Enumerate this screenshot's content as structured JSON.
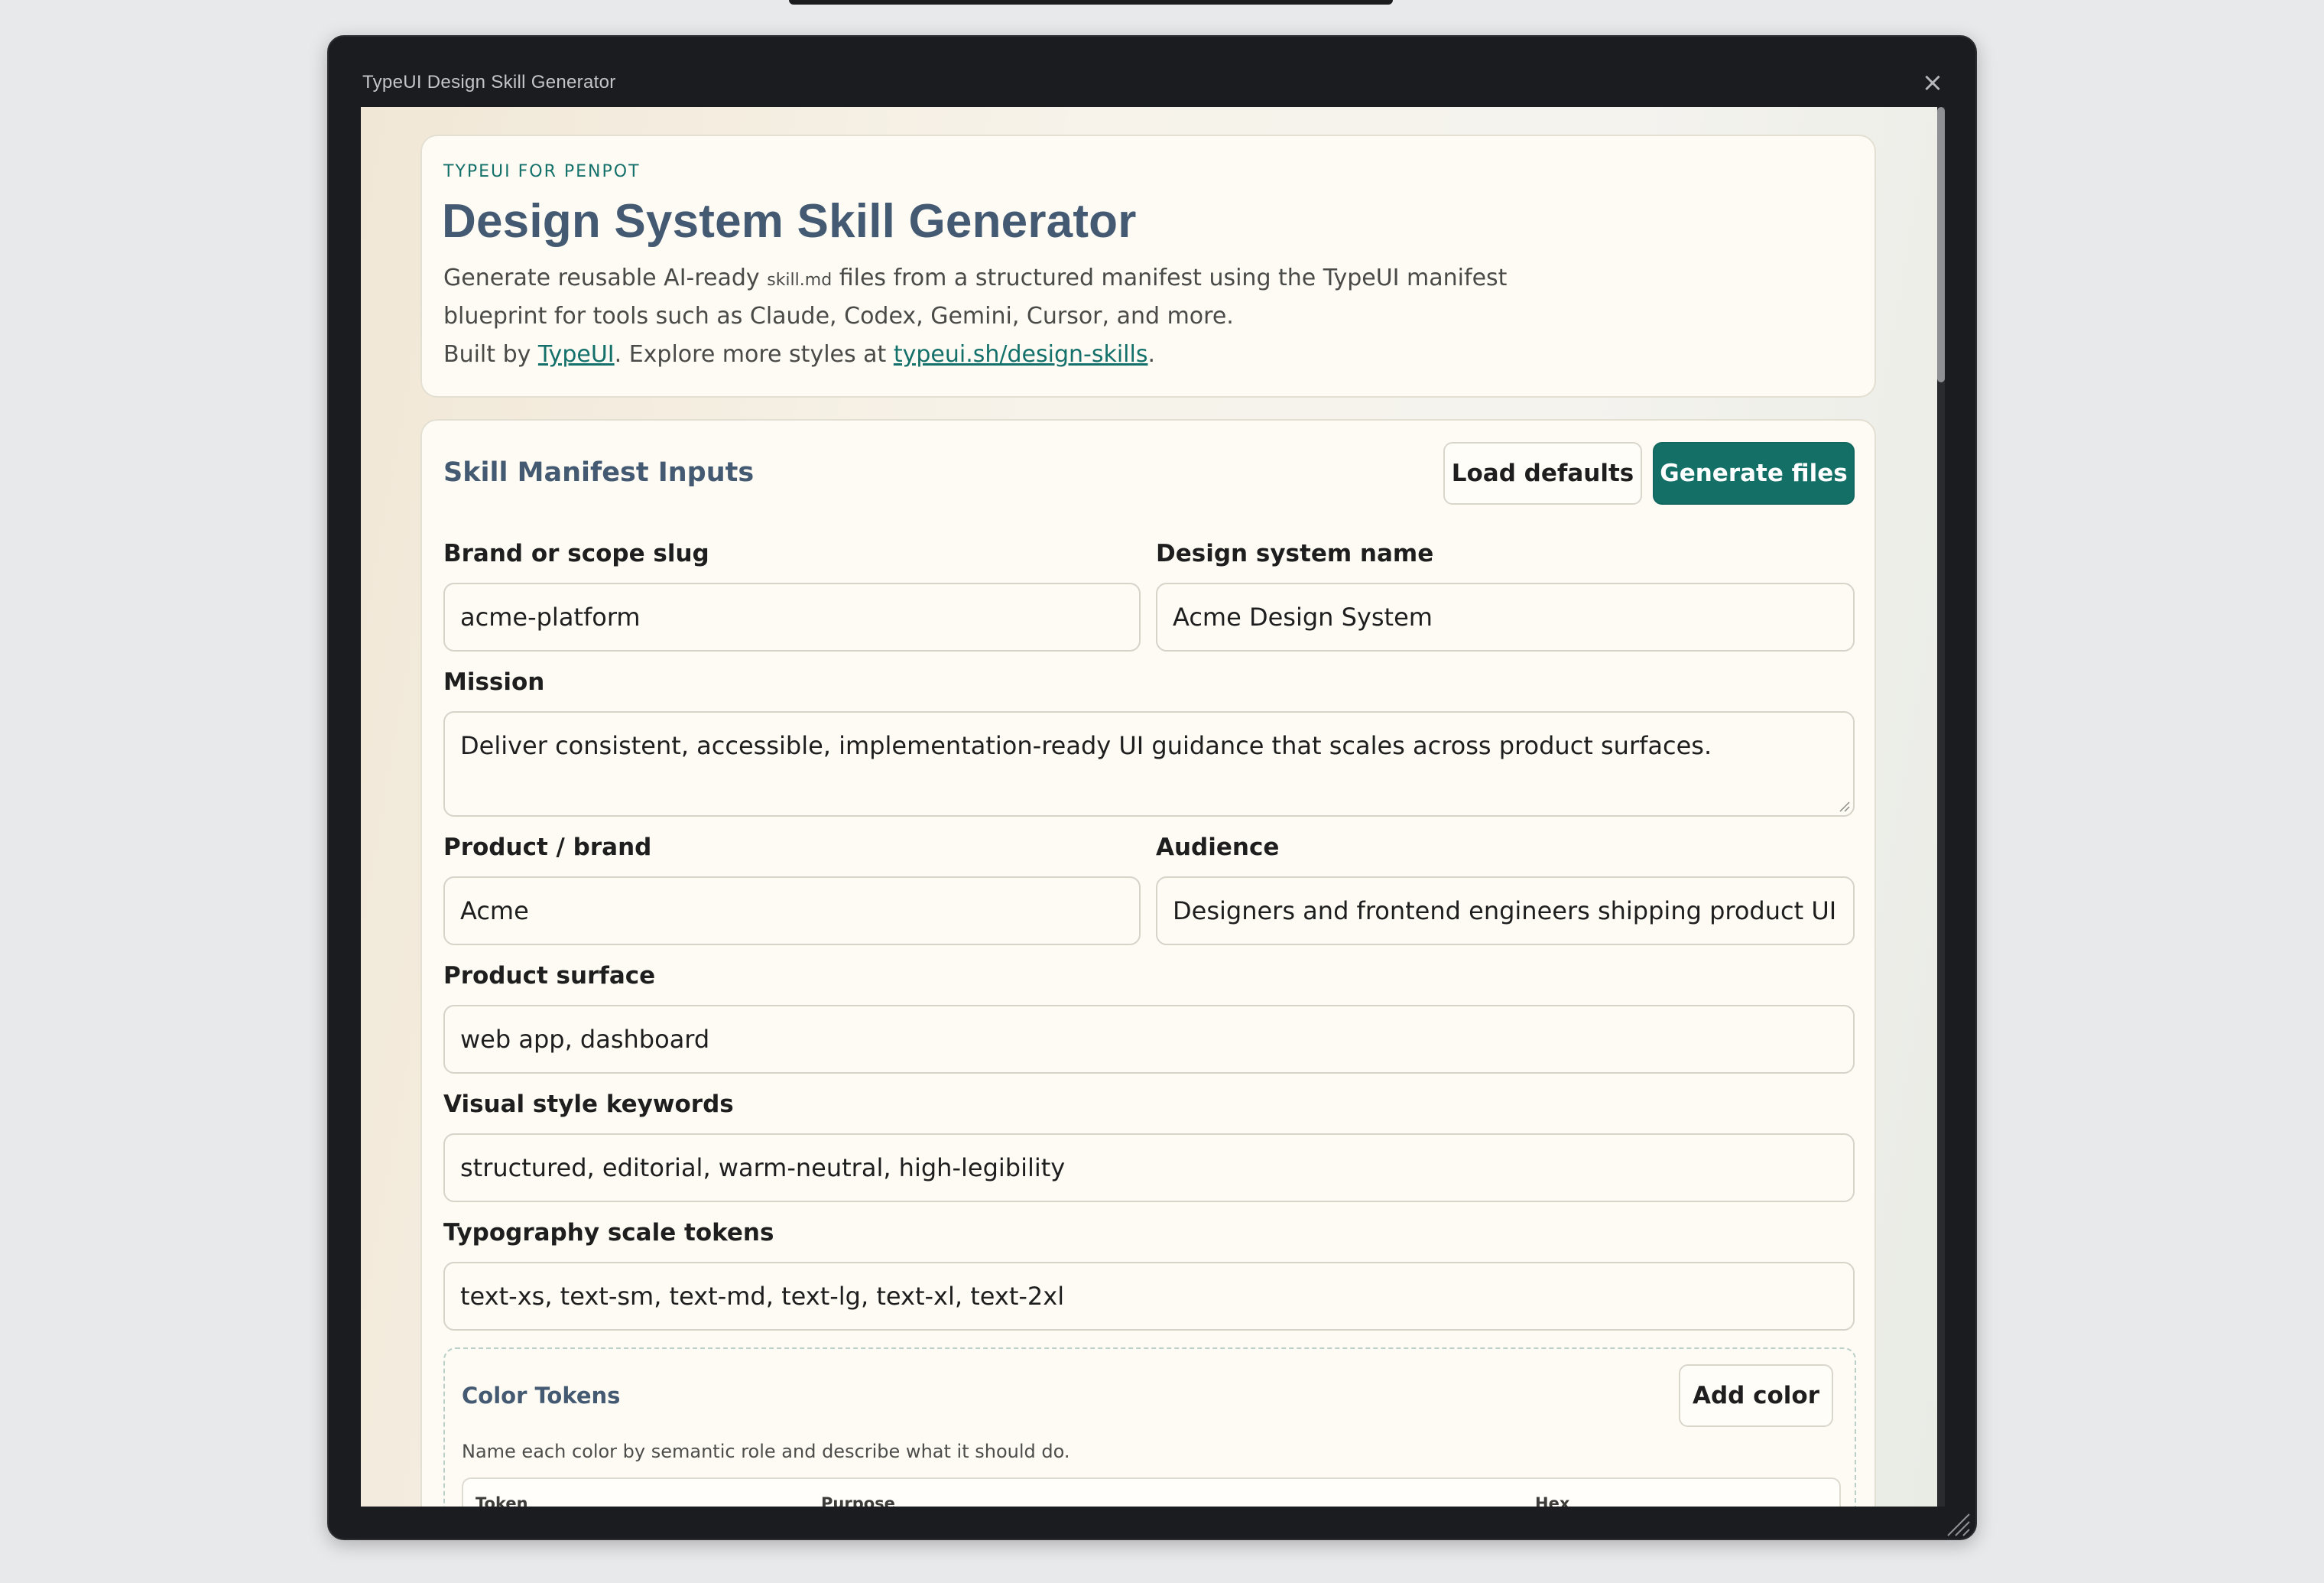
{
  "window": {
    "title": "TypeUI Design Skill Generator",
    "close_glyph": "×"
  },
  "hero": {
    "eyebrow": "TYPEUI FOR PENPOT",
    "title": "Design System Skill Generator",
    "desc_before": "Generate reusable AI-ready ",
    "desc_code": "skill.md",
    "desc_after": " files from a structured manifest using the TypeUI manifest blueprint for tools such as Claude, Codex, Gemini, Cursor, and more.",
    "built_prefix": "Built by ",
    "built_link": "TypeUI",
    "built_middle": ". Explore more styles at ",
    "styles_link": "typeui.sh/design-skills",
    "built_suffix": "."
  },
  "form": {
    "section_title": "Skill Manifest Inputs",
    "load_defaults": "Load defaults",
    "generate_files": "Generate files",
    "brand_slug": {
      "label": "Brand or scope slug",
      "value": "acme-platform"
    },
    "design_system_name": {
      "label": "Design system name",
      "value": "Acme Design System"
    },
    "mission": {
      "label": "Mission",
      "value": "Deliver consistent, accessible, implementation-ready UI guidance that scales across product surfaces."
    },
    "product_brand": {
      "label": "Product / brand",
      "value": "Acme"
    },
    "audience": {
      "label": "Audience",
      "value": "Designers and frontend engineers shipping product UI"
    },
    "product_surface": {
      "label": "Product surface",
      "value": "web app, dashboard"
    },
    "visual_style": {
      "label": "Visual style keywords",
      "value": "structured, editorial, warm-neutral, high-legibility"
    },
    "typography": {
      "label": "Typography scale tokens",
      "value": "text-xs, text-sm, text-md, text-lg, text-xl, text-2xl"
    }
  },
  "color_tokens": {
    "title": "Color Tokens",
    "add_color": "Add color",
    "description": "Name each color by semantic role and describe what it should do.",
    "columns": [
      "Token",
      "Purpose",
      "",
      "Hex"
    ]
  },
  "colors": {
    "accent": "#147067",
    "heading": "#445a72",
    "window_chrome": "#1b1c1f"
  }
}
